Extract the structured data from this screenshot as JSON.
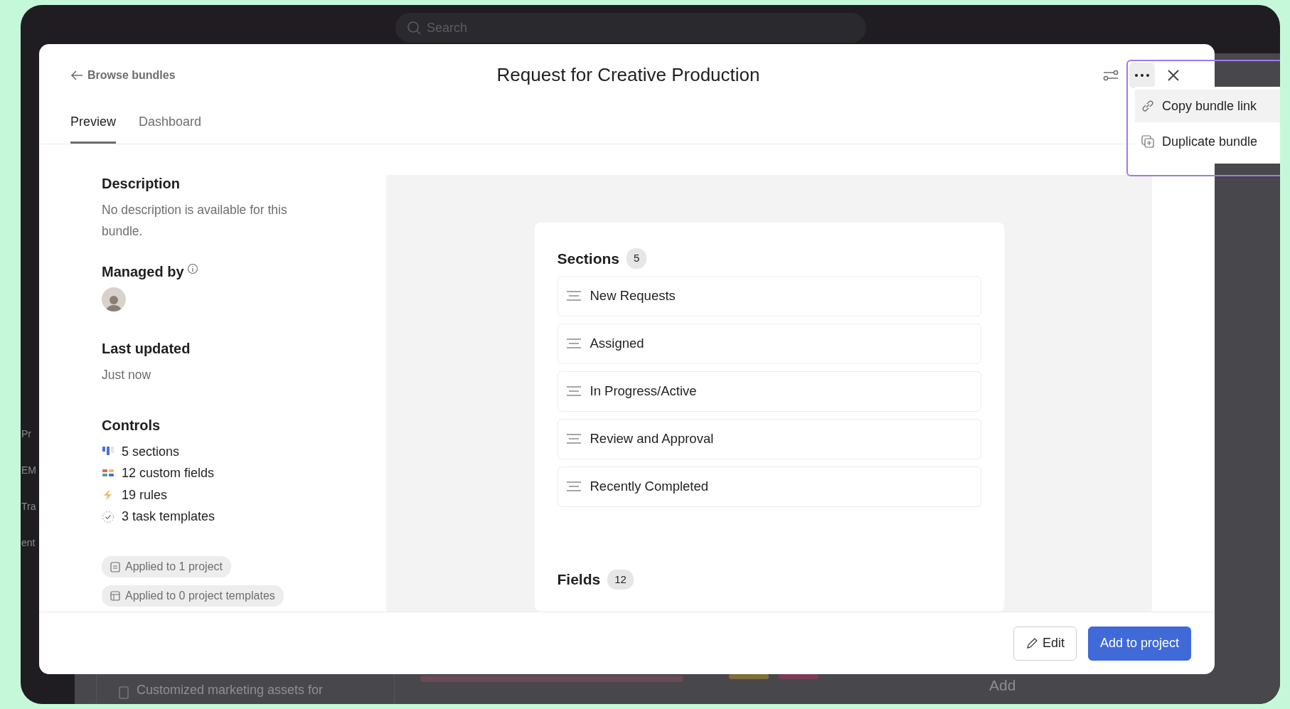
{
  "background": {
    "search_placeholder": "Search",
    "side_fragments": [
      "Pr",
      "EM",
      "Tra",
      "ent"
    ],
    "task": "Customized marketing assets for",
    "column_action": "Add"
  },
  "modal": {
    "back_link": "Browse bundles",
    "title": "Request for Creative Production",
    "tabs": [
      {
        "label": "Preview",
        "selected": true
      },
      {
        "label": "Dashboard",
        "selected": false
      }
    ],
    "menu": {
      "open": true,
      "items": [
        {
          "label": "Copy bundle link",
          "kind": "link",
          "highlighted": true
        },
        {
          "label": "Duplicate bundle",
          "kind": "duplicate",
          "highlighted": false
        }
      ]
    },
    "details": {
      "description_heading": "Description",
      "description": "No description is available for this bundle.",
      "managed_heading": "Managed by",
      "updated_heading": "Last updated",
      "updated": "Just now",
      "controls_heading": "Controls",
      "controls": [
        {
          "kind": "sections",
          "label": "5 sections"
        },
        {
          "kind": "fields",
          "label": "12 custom fields"
        },
        {
          "kind": "rules",
          "label": "19 rules"
        },
        {
          "kind": "templates",
          "label": "3 task templates"
        }
      ],
      "usage": [
        {
          "kind": "project",
          "label": "Applied to 1 project"
        },
        {
          "kind": "template",
          "label": "Applied to 0 project templates"
        }
      ]
    },
    "preview": {
      "sections": {
        "heading": "Sections",
        "count": "5",
        "items": [
          "New Requests",
          "Assigned",
          "In Progress/Active",
          "Review and Approval",
          "Recently Completed"
        ]
      },
      "fields": {
        "heading": "Fields",
        "count": "12"
      }
    },
    "footer_buttons": [
      {
        "label": "Edit",
        "kind": "secondary"
      },
      {
        "label": "Add to project",
        "kind": "primary"
      }
    ]
  }
}
